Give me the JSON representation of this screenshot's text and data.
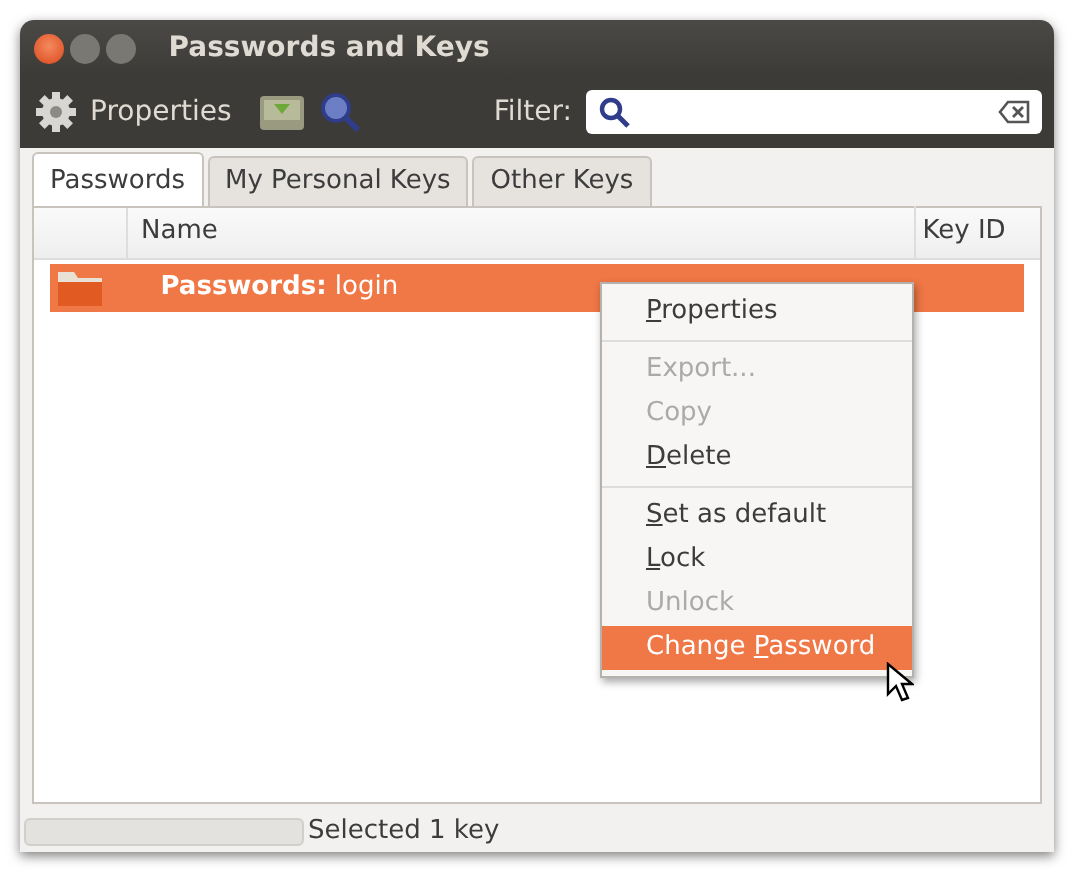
{
  "window": {
    "title": "Passwords and Keys"
  },
  "toolbar": {
    "properties_label": "Properties",
    "filter_label": "Filter:"
  },
  "tabs": [
    {
      "label": "Passwords",
      "selected": true
    },
    {
      "label": "My Personal Keys",
      "selected": false
    },
    {
      "label": "Other Keys",
      "selected": false
    }
  ],
  "table": {
    "columns": [
      "Name",
      "Key ID"
    ],
    "rows": [
      {
        "name": "**Passwords:** login",
        "selected": true
      }
    ]
  },
  "context_menu": [
    {
      "kind": "item",
      "mnemonic": "P",
      "after": "roperties",
      "disabled": false,
      "selected": false
    },
    {
      "kind": "separator"
    },
    {
      "kind": "item",
      "before": "Export...",
      "disabled": true,
      "selected": false
    },
    {
      "kind": "item",
      "before": "Copy",
      "disabled": true,
      "selected": false
    },
    {
      "kind": "item",
      "mnemonic": "D",
      "after": "elete",
      "disabled": false,
      "selected": false
    },
    {
      "kind": "separator"
    },
    {
      "kind": "item",
      "mnemonic": "S",
      "after": "et as default",
      "disabled": false,
      "selected": false
    },
    {
      "kind": "item",
      "mnemonic": "L",
      "after": "ock",
      "disabled": false,
      "selected": false
    },
    {
      "kind": "item",
      "before": "Unlock",
      "disabled": true,
      "selected": false
    },
    {
      "kind": "item",
      "before": "Change ",
      "mnemonic": "P",
      "after": "assword",
      "disabled": false,
      "selected": true
    }
  ],
  "status_bar": {
    "progress": {
      "level": 0
    },
    "text": "Selected 1 key"
  }
}
